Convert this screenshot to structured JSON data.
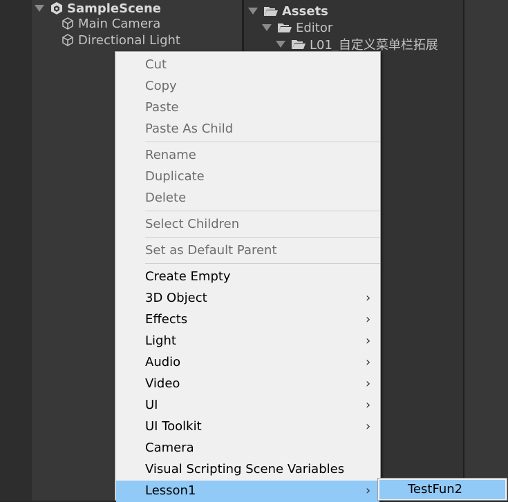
{
  "hierarchy": {
    "scene_name": "SampleScene",
    "items": [
      {
        "label": "Main Camera"
      },
      {
        "label": "Directional Light"
      }
    ]
  },
  "project": {
    "tree": [
      {
        "label": "Assets"
      },
      {
        "label": "Editor"
      },
      {
        "label": "L01_自定义菜单栏拓展"
      }
    ]
  },
  "context_menu": {
    "items": [
      {
        "label": "Cut",
        "disabled": true
      },
      {
        "label": "Copy",
        "disabled": true
      },
      {
        "label": "Paste",
        "disabled": true
      },
      {
        "label": "Paste As Child",
        "disabled": true
      },
      {
        "label": "Rename",
        "disabled": true
      },
      {
        "label": "Duplicate",
        "disabled": true
      },
      {
        "label": "Delete",
        "disabled": true
      },
      {
        "label": "Select Children",
        "disabled": true
      },
      {
        "label": "Set as Default Parent",
        "disabled": true
      },
      {
        "label": "Create Empty",
        "disabled": false
      },
      {
        "label": "3D Object",
        "disabled": false,
        "submenu": true
      },
      {
        "label": "Effects",
        "disabled": false,
        "submenu": true
      },
      {
        "label": "Light",
        "disabled": false,
        "submenu": true
      },
      {
        "label": "Audio",
        "disabled": false,
        "submenu": true
      },
      {
        "label": "Video",
        "disabled": false,
        "submenu": true
      },
      {
        "label": "UI",
        "disabled": false,
        "submenu": true
      },
      {
        "label": "UI Toolkit",
        "disabled": false,
        "submenu": true
      },
      {
        "label": "Camera",
        "disabled": false
      },
      {
        "label": "Visual Scripting Scene Variables",
        "disabled": false
      },
      {
        "label": "Lesson1",
        "disabled": false,
        "submenu": true,
        "highlighted": true
      }
    ],
    "submenu_arrow": "›"
  },
  "submenu": {
    "items": [
      {
        "label": "TestFun2"
      }
    ]
  },
  "colors": {
    "highlight": "#91c9f7",
    "menu_bg": "#f0f0f0",
    "panel_bg": "#383838"
  }
}
